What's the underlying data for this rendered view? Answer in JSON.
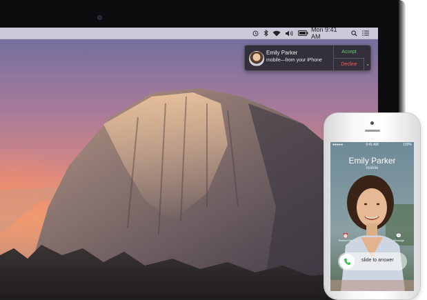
{
  "menubar": {
    "icons": [
      "time-machine-icon",
      "bluetooth-icon",
      "wifi-icon",
      "volume-icon",
      "battery-icon",
      "spotlight-icon",
      "notification-center-icon"
    ],
    "clock": "Mon 9:41 AM"
  },
  "notification": {
    "caller_name": "Emily Parker",
    "caller_detail": "mobile—from your iPhone",
    "accept_label": "Accept",
    "decline_label": "Decline",
    "chevron": "⌄"
  },
  "iphone": {
    "status_time": "9:41 AM",
    "status_battery": "100%",
    "caller_name": "Emily Parker",
    "caller_detail": "mobile",
    "remind_label": "Remind Me",
    "message_label": "Message",
    "slide_text": "slide to answer"
  },
  "colors": {
    "accept": "#5fd068",
    "decline": "#ff5a5a"
  }
}
